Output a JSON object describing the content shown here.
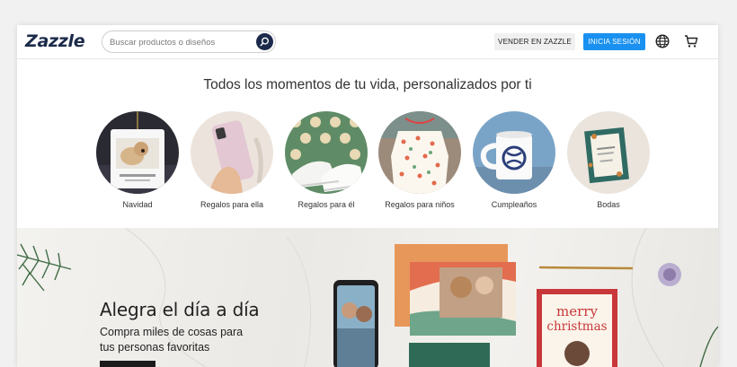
{
  "header": {
    "logo": "Zazzle",
    "search_placeholder": "Buscar productos o diseños",
    "sell_label": "VENDER EN ZAZZLE",
    "login_label": "INICIA SESIÓN"
  },
  "categories_section": {
    "headline": "Todos los momentos de tu vida, personalizados por ti",
    "items": [
      {
        "label": "Navidad"
      },
      {
        "label": "Regalos para ella"
      },
      {
        "label": "Regalos para él"
      },
      {
        "label": "Regalos para niños"
      },
      {
        "label": "Cumpleaños"
      },
      {
        "label": "Bodas"
      }
    ]
  },
  "hero": {
    "title": "Alegra el día a día",
    "subtitle": "Compra miles de cosas para tus personas favoritas",
    "card_text": "merry christmas"
  },
  "colors": {
    "brand_navy": "#1b2a4a",
    "login_blue": "#1a91f0"
  }
}
